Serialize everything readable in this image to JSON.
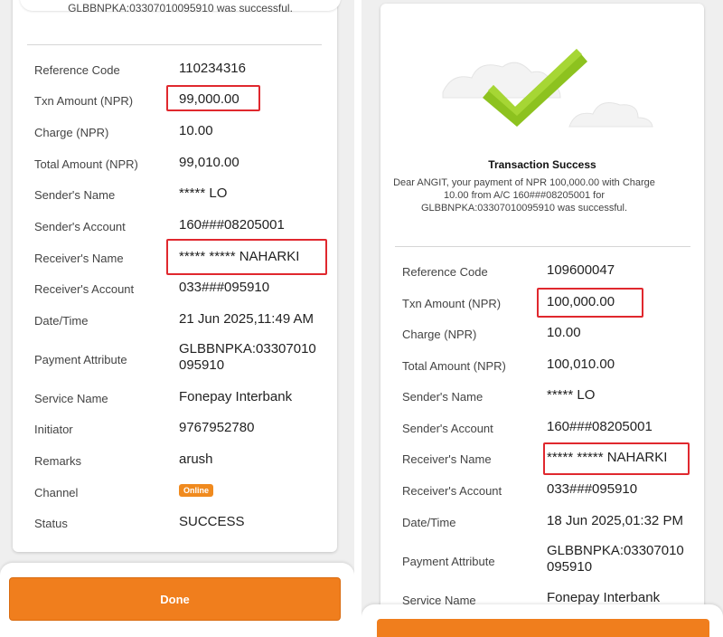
{
  "left": {
    "top_message": "GLBBNPKA:03307010095910 was successful.",
    "rows": [
      {
        "label": "Reference Code",
        "value": "110234316"
      },
      {
        "label": "Txn Amount (NPR)",
        "value": "99,000.00"
      },
      {
        "label": "Charge (NPR)",
        "value": "10.00"
      },
      {
        "label": "Total Amount (NPR)",
        "value": "99,010.00"
      },
      {
        "label": "Sender's Name",
        "value": "***** LO"
      },
      {
        "label": "Sender's Account",
        "value": "160###08205001"
      },
      {
        "label": "Receiver's Name",
        "value": "***** ***** NAHARKI"
      },
      {
        "label": "Receiver's Account",
        "value": "033###095910"
      },
      {
        "label": "Date/Time",
        "value": "21 Jun 2025,11:49 AM"
      },
      {
        "label": "Payment Attribute",
        "value_line1": "GLBBNPKA:03307010",
        "value_line2": "095910"
      },
      {
        "label": "Service Name",
        "value": "Fonepay Interbank"
      },
      {
        "label": "Initiator",
        "value": "9767952780"
      },
      {
        "label": "Remarks",
        "value": "arush"
      },
      {
        "label": "Channel",
        "value": "Online"
      },
      {
        "label": "Status",
        "value": "SUCCESS"
      }
    ],
    "done_label": "Done"
  },
  "right": {
    "title": "Transaction Success",
    "message": "Dear ANGIT, your payment of NPR 100,000.00 with Charge 10.00 from A/C 160###08205001 for GLBBNPKA:03307010095910 was successful.",
    "rows": [
      {
        "label": "Reference Code",
        "value": "109600047"
      },
      {
        "label": "Txn Amount (NPR)",
        "value": "100,000.00"
      },
      {
        "label": "Charge (NPR)",
        "value": "10.00"
      },
      {
        "label": "Total Amount (NPR)",
        "value": "100,010.00"
      },
      {
        "label": "Sender's Name",
        "value": "***** LO"
      },
      {
        "label": "Sender's Account",
        "value": "160###08205001"
      },
      {
        "label": "Receiver's Name",
        "value": "***** ***** NAHARKI"
      },
      {
        "label": "Receiver's Account",
        "value": "033###095910"
      },
      {
        "label": "Date/Time",
        "value": "18 Jun 2025,01:32 PM"
      },
      {
        "label": "Payment Attribute",
        "value_line1": "GLBBNPKA:03307010",
        "value_line2": "095910"
      },
      {
        "label": "Service Name",
        "value": "Fonepay Interbank"
      }
    ]
  },
  "colors": {
    "accent": "#f07e1d",
    "highlight": "#e0282e",
    "check": "#8dc21f"
  }
}
